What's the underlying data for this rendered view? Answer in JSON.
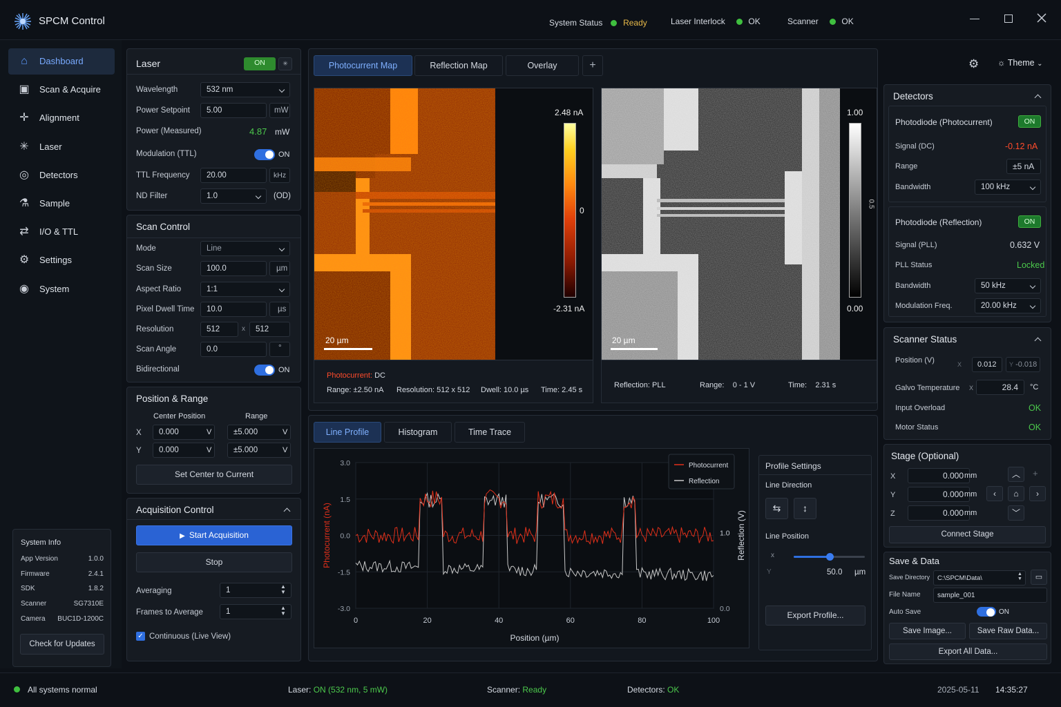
{
  "app": {
    "title": "SPCM Control"
  },
  "status": {
    "system_label": "System Status",
    "system_value": "Ready",
    "laser_label": "Laser Interlock",
    "laser_value": "OK",
    "scanner_label": "Scanner",
    "scanner_value": "OK"
  },
  "nav": {
    "items": [
      {
        "label": "Dashboard",
        "icon": "home-icon"
      },
      {
        "label": "Scan & Acquire",
        "icon": "scan-icon"
      },
      {
        "label": "Alignment",
        "icon": "crosshair-icon"
      },
      {
        "label": "Laser",
        "icon": "laser-icon"
      },
      {
        "label": "Detectors",
        "icon": "detector-icon"
      },
      {
        "label": "Sample",
        "icon": "sample-icon"
      },
      {
        "label": "I/O & TTL",
        "icon": "io-icon"
      },
      {
        "label": "Settings",
        "icon": "gear-icon"
      },
      {
        "label": "System",
        "icon": "system-icon"
      }
    ]
  },
  "sysinfo": {
    "title": "System Info",
    "rows": [
      [
        "App Version",
        "1.0.0"
      ],
      [
        "Firmware",
        "2.4.1"
      ],
      [
        "SDK",
        "1.8.2"
      ],
      [
        "Scanner",
        "SG7310E"
      ],
      [
        "Camera",
        "BUC1D-1200C"
      ]
    ],
    "update_btn": "Check for Updates"
  },
  "laser": {
    "title": "Laser",
    "toggle": "ON",
    "wavelength_label": "Wavelength",
    "wavelength": "532 nm",
    "power_label": "Power Setpoint",
    "power": "5.00",
    "power_unit": "mW",
    "measured_label": "Power (Measured)",
    "measured": "4.87",
    "measured_unit": "mW",
    "mod_label": "Modulation (TTL)",
    "mod": "ON",
    "ttl_label": "TTL Frequency",
    "ttl": "20.00",
    "ttl_unit": "kHz",
    "nd_label": "ND Filter",
    "nd": "1.0",
    "nd_unit": "(OD)"
  },
  "scan": {
    "title": "Scan Control",
    "mode_label": "Mode",
    "mode": "Line",
    "size_label": "Scan Size",
    "size": "100.0",
    "size_unit": "µm",
    "aspect_label": "Aspect Ratio",
    "aspect": "1:1",
    "dwell_label": "Pixel Dwell Time",
    "dwell": "10.0",
    "dwell_unit": "µs",
    "res_label": "Resolution",
    "res_x": "512",
    "res_sep": "x",
    "res_y": "512",
    "angle_label": "Scan Angle",
    "angle": "0.0",
    "angle_unit": "°",
    "bidir_label": "Bidirectional",
    "bidir": "ON"
  },
  "position": {
    "title": "Position & Range",
    "center_hdr": "Center Position",
    "range_hdr": "Range",
    "x_label": "X",
    "y_label": "Y",
    "x": "0.000",
    "y": "0.000",
    "x_range": "±5.000",
    "y_range": "±5.000",
    "unit": "V",
    "set_btn": "Set Center to Current"
  },
  "acq": {
    "title": "Acquisition Control",
    "start": "Start Acquisition",
    "stop": "Stop",
    "avg_label": "Averaging",
    "avg": "1",
    "frames_label": "Frames to Average",
    "frames": "1",
    "continuous": "Continuous (Live View)"
  },
  "tabs": {
    "items": [
      "Photocurrent Map",
      "Reflection Map",
      "Overlay"
    ],
    "add": "+",
    "theme": "Theme"
  },
  "map1": {
    "max": "2.48 nA",
    "zero": "0",
    "min": "-2.31 nA",
    "scale": "20 µm",
    "info_label": "Photocurrent:",
    "info_value": "DC",
    "range": "Range:  ±2.50 nA",
    "res": "Resolution: 512 x 512",
    "dwell": "Dwell: 10.0 µs",
    "time": "Time: 2.45 s"
  },
  "map2": {
    "max": "1.00",
    "min": "0.00",
    "side": "0.5",
    "scale": "20 µm",
    "info_label": "Reflection:",
    "info_value": "PLL",
    "range_label": "Range:",
    "range": "0 - 1 V",
    "time_label": "Time:",
    "time": "2.31 s"
  },
  "bottom_tabs": {
    "items": [
      "Line Profile",
      "Histogram",
      "Time Trace"
    ]
  },
  "chart_data": {
    "type": "line",
    "xlabel": "Position (µm)",
    "ylabel": "Photocurrent (nA)",
    "y2label": "Reflection (V)",
    "xlim": [
      0,
      100
    ],
    "ylim": [
      -3,
      3
    ],
    "x_ticks": [
      "0",
      "20",
      "40",
      "60",
      "80",
      "100"
    ],
    "y_ticks": [
      "3.0",
      "1.5",
      "0.0",
      "-1.5",
      "-3.0"
    ],
    "y2_ticks": [
      "1.0",
      "0.0"
    ],
    "legend": [
      "Photocurrent",
      "Reflection"
    ],
    "legend_position": "top-right",
    "colors": {
      "photocurrent": "#e2301a",
      "reflection": "#c8c8c8"
    }
  },
  "profile": {
    "title": "Profile Settings",
    "dir_label": "Line Direction",
    "pos_label": "Line Position",
    "pos_value": "50.0",
    "pos_unit": "µm",
    "slider_level": 0.5,
    "export": "Export Profile..."
  },
  "detectors": {
    "title": "Detectors",
    "pd1": "Photodiode (Photocurrent)",
    "pd1_toggle": "ON",
    "signal_dc_label": "Signal (DC)",
    "signal_dc": "-0.12 nA",
    "range_label": "Range",
    "range": "±5  nA",
    "bw_label": "Bandwidth",
    "bw1": "100 kHz",
    "pd2": "Photodiode (Reflection)",
    "pd2_toggle": "ON",
    "signal_pll_label": "Signal (PLL)",
    "signal_pll": "0.632 V",
    "pll_label": "PLL Status",
    "pll": "Locked",
    "bw2": "50 kHz",
    "modf_label": "Modulation Freq.",
    "modf": "20.00 kHz"
  },
  "scanner": {
    "title": "Scanner Status",
    "pos_label": "Position (V)",
    "pos_x_label": "X",
    "pos_x": "0.012",
    "pos_y_label": "Y",
    "pos_y": "-0.018",
    "galvo_label": "Galvo Temperature",
    "galvo_x": "X",
    "galvo": "28.4",
    "galvo_unit": "°C",
    "overload_label": "Input Overload",
    "overload": "OK",
    "motor_label": "Motor Status",
    "motor": "OK"
  },
  "stage": {
    "title": "Stage (Optional)",
    "x_label": "X",
    "y_label": "Y",
    "z_label": "Z",
    "x": "0.000",
    "y": "0.000",
    "z": "0.000",
    "unit": "mm",
    "connect": "Connect Stage"
  },
  "save": {
    "title": "Save & Data",
    "dir_label": "Save Directory",
    "dir": "C:\\SPCM\\Data\\",
    "file_label": "File Name",
    "file": "sample_001",
    "auto_label": "Auto Save",
    "auto": "ON",
    "save_image": "Save Image...",
    "save_raw": "Save Raw Data...",
    "export_all": "Export All Data..."
  },
  "footer": {
    "status": "All systems normal",
    "laser_label": "Laser:",
    "laser": "ON (532 nm, 5 mW)",
    "scanner_label": "Scanner:",
    "scanner": "Ready",
    "detectors_label": "Detectors:",
    "detectors": "OK",
    "date": "2025-05-11",
    "time": "14:35:27"
  }
}
